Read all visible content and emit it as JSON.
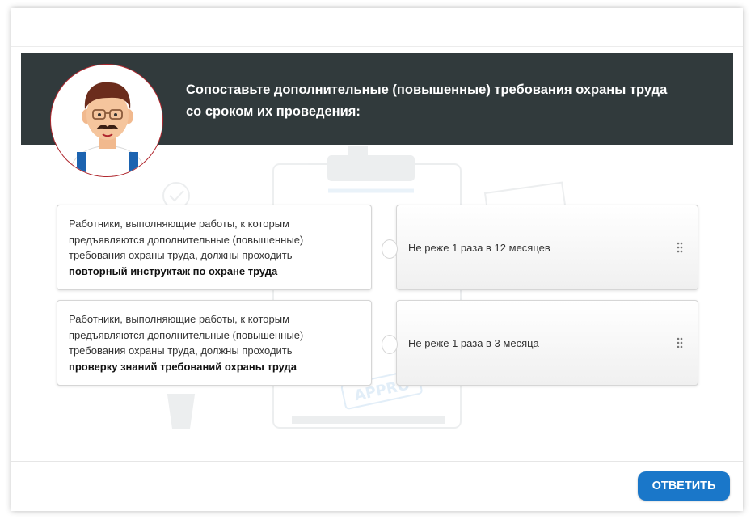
{
  "question": {
    "text": "Сопоставьте дополнительные (повышенные) требования охраны труда со сроком их проведения:"
  },
  "avatar": {
    "icon": "worker-avatar-icon"
  },
  "pairs": [
    {
      "left": {
        "text": "Работники, выполняющие работы, к которым предъявляются дополнительные (повышенные) требования охраны труда, должны проходить",
        "bold": "повторный инструктаж по охране труда"
      },
      "right": {
        "text": "Не реже 1 раза в 12 месяцев"
      }
    },
    {
      "left": {
        "text": "Работники, выполняющие работы, к которым предъявляются дополнительные (повышенные) требования охраны труда, должны проходить",
        "bold": "проверку знаний требований охраны труда"
      },
      "right": {
        "text": "Не реже 1 раза в 3 месяца"
      }
    }
  ],
  "background": {
    "stamp_text": "APPRO"
  },
  "footer": {
    "submit_label": "ОТВЕТИТЬ"
  },
  "colors": {
    "header_bg": "#313a3c",
    "button_bg": "#1a77c9",
    "avatar_border": "#b0282f"
  }
}
